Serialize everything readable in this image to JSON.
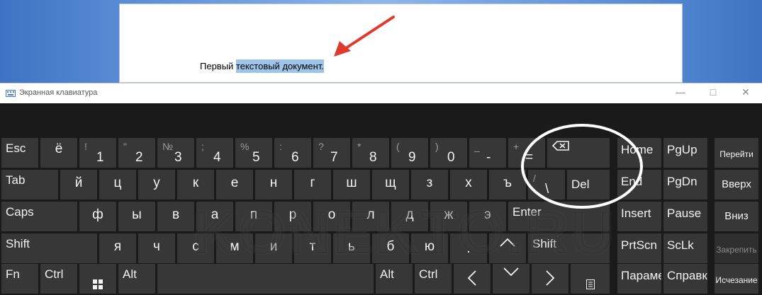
{
  "document": {
    "text_before": "Первый ",
    "text_selected": "текстовый документ.",
    "text_after": ""
  },
  "window": {
    "title": "Экранная клавиатура"
  },
  "rows": [
    [
      {
        "id": "esc",
        "label": "Esc"
      },
      {
        "id": "yo",
        "main": "ё"
      },
      {
        "id": "1",
        "sec": "!",
        "main": "1"
      },
      {
        "id": "2",
        "sec": "\"",
        "main": "2"
      },
      {
        "id": "3",
        "sec": "№",
        "main": "3"
      },
      {
        "id": "4",
        "sec": ";",
        "main": "4"
      },
      {
        "id": "5",
        "sec": "%",
        "main": "5"
      },
      {
        "id": "6",
        "sec": ":",
        "main": "6"
      },
      {
        "id": "7",
        "sec": "?",
        "main": "7"
      },
      {
        "id": "8",
        "sec": "*",
        "main": "8"
      },
      {
        "id": "9",
        "sec": "(",
        "main": "9"
      },
      {
        "id": "0",
        "sec": ")",
        "main": "0"
      },
      {
        "id": "minus",
        "sec": "_",
        "main": "-"
      },
      {
        "id": "equals",
        "sec": "+",
        "main": "="
      },
      {
        "id": "backspace",
        "icon": "backspace-icon"
      }
    ],
    [
      {
        "id": "tab",
        "label": "Tab"
      },
      {
        "id": "j",
        "main": "й"
      },
      {
        "id": "ts",
        "main": "ц"
      },
      {
        "id": "u",
        "main": "у"
      },
      {
        "id": "k",
        "main": "к"
      },
      {
        "id": "e",
        "main": "е"
      },
      {
        "id": "n",
        "main": "н"
      },
      {
        "id": "g",
        "main": "г"
      },
      {
        "id": "sh",
        "main": "ш"
      },
      {
        "id": "shch",
        "main": "щ"
      },
      {
        "id": "z",
        "main": "з"
      },
      {
        "id": "h",
        "main": "х"
      },
      {
        "id": "hard",
        "main": "ъ"
      },
      {
        "id": "backslash",
        "sec": "/",
        "main": "\\"
      },
      {
        "id": "del",
        "label": "Del"
      }
    ],
    [
      {
        "id": "caps",
        "label": "Caps"
      },
      {
        "id": "f",
        "main": "ф"
      },
      {
        "id": "y",
        "main": "ы"
      },
      {
        "id": "v",
        "main": "в"
      },
      {
        "id": "a",
        "main": "а"
      },
      {
        "id": "p",
        "main": "п"
      },
      {
        "id": "r",
        "main": "р"
      },
      {
        "id": "o",
        "main": "о"
      },
      {
        "id": "l",
        "main": "л"
      },
      {
        "id": "d",
        "main": "д"
      },
      {
        "id": "zh",
        "main": "ж"
      },
      {
        "id": "ee",
        "main": "э"
      },
      {
        "id": "enter",
        "label": "Enter"
      }
    ],
    [
      {
        "id": "shift-left",
        "label": "Shift"
      },
      {
        "id": "ya",
        "main": "я"
      },
      {
        "id": "ch",
        "main": "ч"
      },
      {
        "id": "s",
        "main": "с"
      },
      {
        "id": "m",
        "main": "м"
      },
      {
        "id": "i",
        "main": "и"
      },
      {
        "id": "t",
        "main": "т"
      },
      {
        "id": "soft",
        "main": "ь"
      },
      {
        "id": "b",
        "main": "б"
      },
      {
        "id": "yu",
        "main": "ю"
      },
      {
        "id": "period",
        "main": "."
      },
      {
        "id": "up",
        "icon": "chevron-up-icon"
      },
      {
        "id": "shift-right",
        "label": "Shift"
      }
    ],
    [
      {
        "id": "fn",
        "label": "Fn"
      },
      {
        "id": "ctrl-left",
        "label": "Ctrl"
      },
      {
        "id": "win",
        "icon": "windows-icon"
      },
      {
        "id": "alt-left",
        "label": "Alt"
      },
      {
        "id": "space",
        "label": ""
      },
      {
        "id": "alt-right",
        "label": "Alt"
      },
      {
        "id": "ctrl-right",
        "label": "Ctrl"
      },
      {
        "id": "left",
        "icon": "chevron-left-icon"
      },
      {
        "id": "down",
        "icon": "chevron-down-icon"
      },
      {
        "id": "right",
        "icon": "chevron-right-icon"
      },
      {
        "id": "menu",
        "icon": "menu-icon"
      }
    ]
  ],
  "nav": [
    {
      "id": "home",
      "label": "Home"
    },
    {
      "id": "pgup",
      "label": "PgUp"
    },
    {
      "id": "end",
      "label": "End"
    },
    {
      "id": "pgdn",
      "label": "PgDn"
    },
    {
      "id": "insert",
      "label": "Insert"
    },
    {
      "id": "pause",
      "label": "Pause"
    },
    {
      "id": "prtscn",
      "label": "PrtScn"
    },
    {
      "id": "sclk",
      "label": "ScLk"
    },
    {
      "id": "params",
      "label": "Параметры"
    },
    {
      "id": "help",
      "label": "Справка"
    }
  ],
  "side": [
    {
      "id": "goto",
      "label": "Перейти"
    },
    {
      "id": "up",
      "label": "Вверх"
    },
    {
      "id": "down",
      "label": "Вниз"
    },
    {
      "id": "pin",
      "label": "Закрепить"
    },
    {
      "id": "fade",
      "label": "Исчезание"
    }
  ],
  "watermark": "KONEKTO.RU",
  "colors": {
    "key": "#373737",
    "bg": "#1a1a1a",
    "selection": "#9ec4ea",
    "arrow": "#e03a2e"
  }
}
